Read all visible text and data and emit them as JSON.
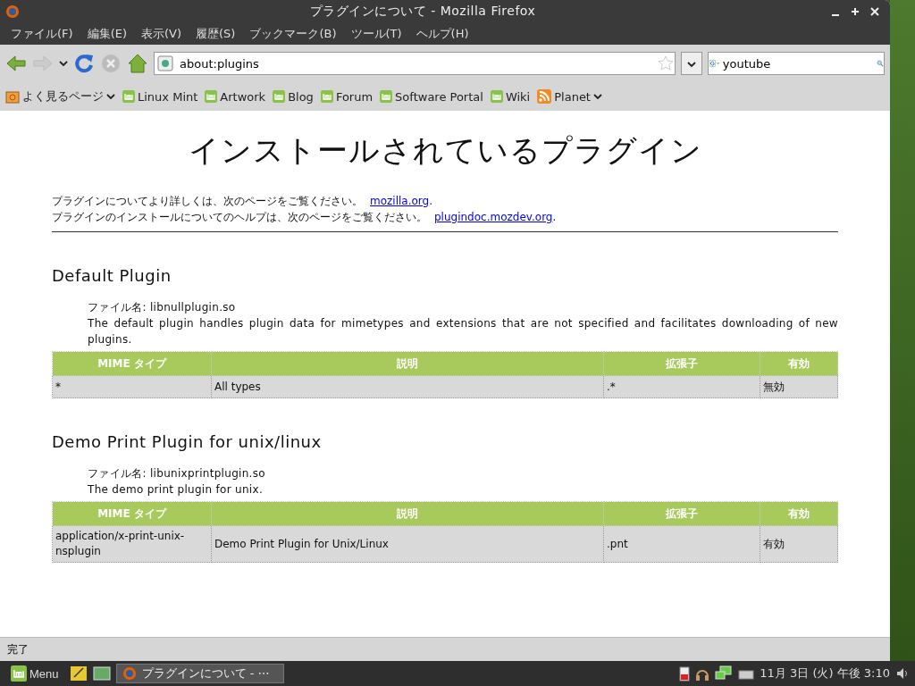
{
  "window": {
    "title": "プラグインについて - Mozilla Firefox"
  },
  "menu": [
    "ファイル(F)",
    "編集(E)",
    "表示(V)",
    "履歴(S)",
    "ブックマーク(B)",
    "ツール(T)",
    "ヘルプ(H)"
  ],
  "address": {
    "value": "about:plugins"
  },
  "search": {
    "value": "youtube"
  },
  "bookmarks": [
    {
      "label": "よく見るページ",
      "kind": "folder"
    },
    {
      "label": "Linux Mint",
      "kind": "mint"
    },
    {
      "label": "Artwork",
      "kind": "mint"
    },
    {
      "label": "Blog",
      "kind": "mint"
    },
    {
      "label": "Forum",
      "kind": "mint"
    },
    {
      "label": "Software Portal",
      "kind": "mint"
    },
    {
      "label": "Wiki",
      "kind": "mint"
    },
    {
      "label": "Planet",
      "kind": "feed"
    }
  ],
  "page": {
    "heading": "インストールされているプラグイン",
    "intro": [
      {
        "text": "プラグインについてより詳しくは、次のページをご覧ください。",
        "link": "mozilla.org",
        "after": "."
      },
      {
        "text": "プラグインのインストールについてのヘルプは、次のページをご覧ください。",
        "link": "plugindoc.mozdev.org",
        "after": "."
      }
    ],
    "plugins": [
      {
        "name": "Default Plugin",
        "file": "ファイル名: libnullplugin.so",
        "description": "The default plugin handles plugin data for mimetypes and extensions that are not specified and facilitates downloading of new plugins.",
        "columns": [
          "MIME タイプ",
          "説明",
          "拡張子",
          "有効"
        ],
        "rows": [
          [
            "*",
            "All types",
            ".*",
            "無効"
          ]
        ]
      },
      {
        "name": "Demo Print Plugin for unix/linux",
        "file": "ファイル名: libunixprintplugin.so",
        "description": "The demo print plugin for unix.",
        "columns": [
          "MIME タイプ",
          "説明",
          "拡張子",
          "有効"
        ],
        "rows": [
          [
            "application/x-print-unix-nsplugin",
            "Demo Print Plugin for Unix/Linux",
            ".pnt",
            "有効"
          ]
        ]
      }
    ]
  },
  "status_bar": "完了",
  "taskbar": {
    "menu": "Menu",
    "task": "プラグインについて - ⋯",
    "clock": "11月 3日 (火) 午後 3:10"
  }
}
